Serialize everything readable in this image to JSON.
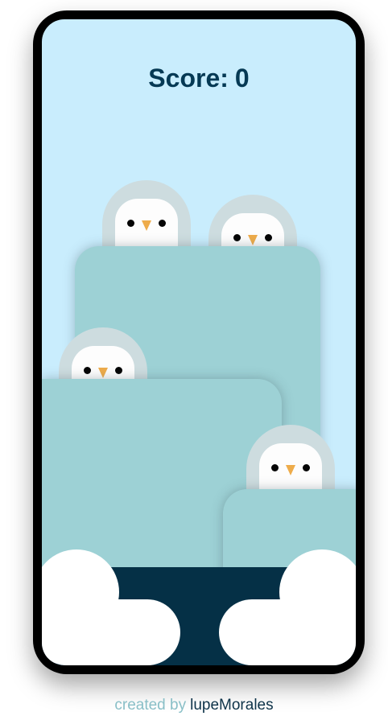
{
  "game": {
    "score_label": "Score:",
    "score_value": "0"
  },
  "footer": {
    "prefix": "created by",
    "author": "lupeMorales"
  },
  "penguins": [
    {
      "id": 1,
      "status": "peeking"
    },
    {
      "id": 2,
      "status": "peeking"
    },
    {
      "id": 3,
      "status": "peeking"
    },
    {
      "id": 4,
      "status": "peeking"
    }
  ],
  "colors": {
    "sky": "#c9edfd",
    "rock": "#9dd1d5",
    "water": "#053046",
    "penguin_body": "#cddcdf",
    "beak": "#eeac4b",
    "score_text": "#053954"
  }
}
